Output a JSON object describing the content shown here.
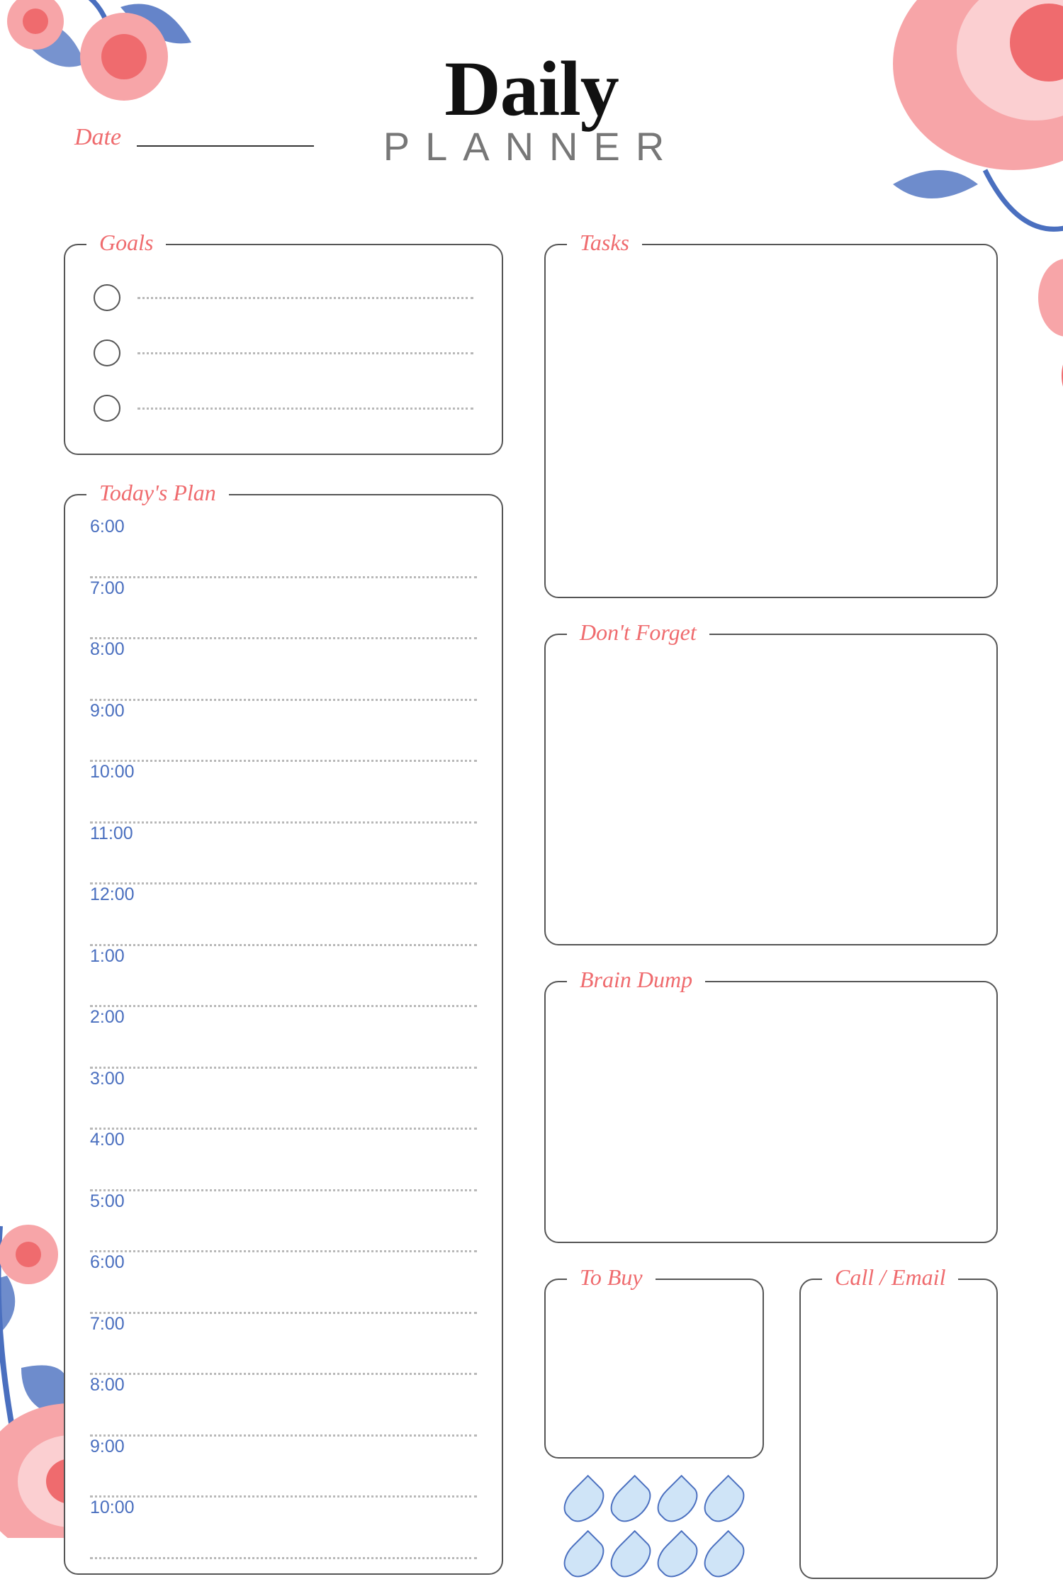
{
  "title": {
    "main": "Daily",
    "sub": "PLANNER"
  },
  "date_label": "Date",
  "sections": {
    "goals": "Goals",
    "tasks": "Tasks",
    "plan": "Today's Plan",
    "forget": "Don't Forget",
    "brain": "Brain Dump",
    "tobuy": "To Buy",
    "call": "Call / Email"
  },
  "goals_count": 3,
  "plan_times": [
    "6:00",
    "7:00",
    "8:00",
    "9:00",
    "10:00",
    "11:00",
    "12:00",
    "1:00",
    "2:00",
    "3:00",
    "4:00",
    "5:00",
    "6:00",
    "7:00",
    "8:00",
    "9:00",
    "10:00"
  ],
  "water_drops": 8,
  "colors": {
    "accent": "#ef6b6e",
    "time": "#4a6fbf",
    "drop_fill": "#cfe4f7"
  }
}
